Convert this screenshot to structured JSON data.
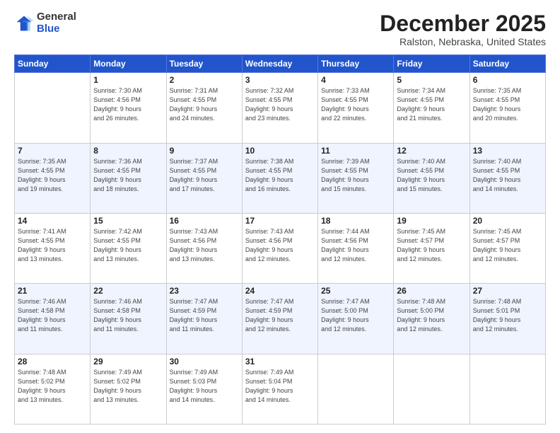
{
  "logo": {
    "general": "General",
    "blue": "Blue"
  },
  "header": {
    "month": "December 2025",
    "location": "Ralston, Nebraska, United States"
  },
  "weekdays": [
    "Sunday",
    "Monday",
    "Tuesday",
    "Wednesday",
    "Thursday",
    "Friday",
    "Saturday"
  ],
  "weeks": [
    [
      {
        "day": "",
        "info": ""
      },
      {
        "day": "1",
        "info": "Sunrise: 7:30 AM\nSunset: 4:56 PM\nDaylight: 9 hours\nand 26 minutes."
      },
      {
        "day": "2",
        "info": "Sunrise: 7:31 AM\nSunset: 4:55 PM\nDaylight: 9 hours\nand 24 minutes."
      },
      {
        "day": "3",
        "info": "Sunrise: 7:32 AM\nSunset: 4:55 PM\nDaylight: 9 hours\nand 23 minutes."
      },
      {
        "day": "4",
        "info": "Sunrise: 7:33 AM\nSunset: 4:55 PM\nDaylight: 9 hours\nand 22 minutes."
      },
      {
        "day": "5",
        "info": "Sunrise: 7:34 AM\nSunset: 4:55 PM\nDaylight: 9 hours\nand 21 minutes."
      },
      {
        "day": "6",
        "info": "Sunrise: 7:35 AM\nSunset: 4:55 PM\nDaylight: 9 hours\nand 20 minutes."
      }
    ],
    [
      {
        "day": "7",
        "info": "Sunrise: 7:35 AM\nSunset: 4:55 PM\nDaylight: 9 hours\nand 19 minutes."
      },
      {
        "day": "8",
        "info": "Sunrise: 7:36 AM\nSunset: 4:55 PM\nDaylight: 9 hours\nand 18 minutes."
      },
      {
        "day": "9",
        "info": "Sunrise: 7:37 AM\nSunset: 4:55 PM\nDaylight: 9 hours\nand 17 minutes."
      },
      {
        "day": "10",
        "info": "Sunrise: 7:38 AM\nSunset: 4:55 PM\nDaylight: 9 hours\nand 16 minutes."
      },
      {
        "day": "11",
        "info": "Sunrise: 7:39 AM\nSunset: 4:55 PM\nDaylight: 9 hours\nand 15 minutes."
      },
      {
        "day": "12",
        "info": "Sunrise: 7:40 AM\nSunset: 4:55 PM\nDaylight: 9 hours\nand 15 minutes."
      },
      {
        "day": "13",
        "info": "Sunrise: 7:40 AM\nSunset: 4:55 PM\nDaylight: 9 hours\nand 14 minutes."
      }
    ],
    [
      {
        "day": "14",
        "info": "Sunrise: 7:41 AM\nSunset: 4:55 PM\nDaylight: 9 hours\nand 13 minutes."
      },
      {
        "day": "15",
        "info": "Sunrise: 7:42 AM\nSunset: 4:55 PM\nDaylight: 9 hours\nand 13 minutes."
      },
      {
        "day": "16",
        "info": "Sunrise: 7:43 AM\nSunset: 4:56 PM\nDaylight: 9 hours\nand 13 minutes."
      },
      {
        "day": "17",
        "info": "Sunrise: 7:43 AM\nSunset: 4:56 PM\nDaylight: 9 hours\nand 12 minutes."
      },
      {
        "day": "18",
        "info": "Sunrise: 7:44 AM\nSunset: 4:56 PM\nDaylight: 9 hours\nand 12 minutes."
      },
      {
        "day": "19",
        "info": "Sunrise: 7:45 AM\nSunset: 4:57 PM\nDaylight: 9 hours\nand 12 minutes."
      },
      {
        "day": "20",
        "info": "Sunrise: 7:45 AM\nSunset: 4:57 PM\nDaylight: 9 hours\nand 12 minutes."
      }
    ],
    [
      {
        "day": "21",
        "info": "Sunrise: 7:46 AM\nSunset: 4:58 PM\nDaylight: 9 hours\nand 11 minutes."
      },
      {
        "day": "22",
        "info": "Sunrise: 7:46 AM\nSunset: 4:58 PM\nDaylight: 9 hours\nand 11 minutes."
      },
      {
        "day": "23",
        "info": "Sunrise: 7:47 AM\nSunset: 4:59 PM\nDaylight: 9 hours\nand 11 minutes."
      },
      {
        "day": "24",
        "info": "Sunrise: 7:47 AM\nSunset: 4:59 PM\nDaylight: 9 hours\nand 12 minutes."
      },
      {
        "day": "25",
        "info": "Sunrise: 7:47 AM\nSunset: 5:00 PM\nDaylight: 9 hours\nand 12 minutes."
      },
      {
        "day": "26",
        "info": "Sunrise: 7:48 AM\nSunset: 5:00 PM\nDaylight: 9 hours\nand 12 minutes."
      },
      {
        "day": "27",
        "info": "Sunrise: 7:48 AM\nSunset: 5:01 PM\nDaylight: 9 hours\nand 12 minutes."
      }
    ],
    [
      {
        "day": "28",
        "info": "Sunrise: 7:48 AM\nSunset: 5:02 PM\nDaylight: 9 hours\nand 13 minutes."
      },
      {
        "day": "29",
        "info": "Sunrise: 7:49 AM\nSunset: 5:02 PM\nDaylight: 9 hours\nand 13 minutes."
      },
      {
        "day": "30",
        "info": "Sunrise: 7:49 AM\nSunset: 5:03 PM\nDaylight: 9 hours\nand 14 minutes."
      },
      {
        "day": "31",
        "info": "Sunrise: 7:49 AM\nSunset: 5:04 PM\nDaylight: 9 hours\nand 14 minutes."
      },
      {
        "day": "",
        "info": ""
      },
      {
        "day": "",
        "info": ""
      },
      {
        "day": "",
        "info": ""
      }
    ]
  ]
}
